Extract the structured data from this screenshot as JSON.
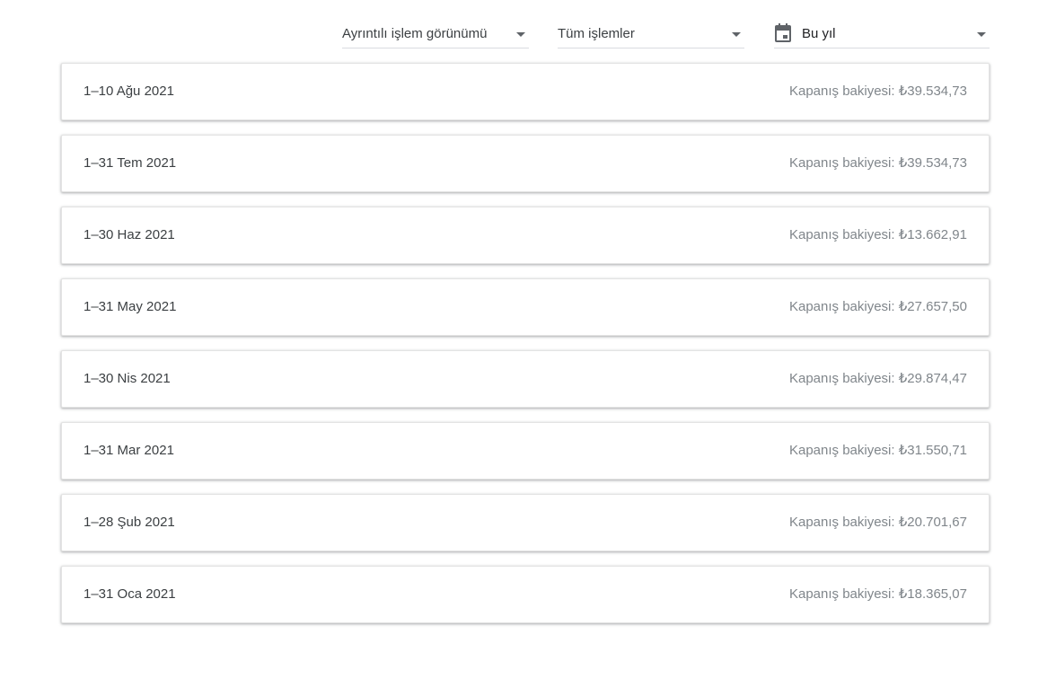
{
  "filters": {
    "view": {
      "label": "Ayrıntılı işlem görünümü"
    },
    "type": {
      "label": "Tüm işlemler"
    },
    "date": {
      "label": "Bu yıl",
      "icon": "calendar-icon"
    }
  },
  "balance_prefix": "Kapanış bakiyesi: ",
  "statements": [
    {
      "period": "1–10 Ağu 2021",
      "balance": "Kapanış bakiyesi: ₺39.534,73"
    },
    {
      "period": "1–31 Tem 2021",
      "balance": "Kapanış bakiyesi: ₺39.534,73"
    },
    {
      "period": "1–30 Haz 2021",
      "balance": "Kapanış bakiyesi: ₺13.662,91"
    },
    {
      "period": "1–31 May 2021",
      "balance": "Kapanış bakiyesi: ₺27.657,50"
    },
    {
      "period": "1–30 Nis 2021",
      "balance": "Kapanış bakiyesi: ₺29.874,47"
    },
    {
      "period": "1–31 Mar 2021",
      "balance": "Kapanış bakiyesi: ₺31.550,71"
    },
    {
      "period": "1–28 Şub 2021",
      "balance": "Kapanış bakiyesi: ₺20.701,67"
    },
    {
      "period": "1–31 Oca 2021",
      "balance": "Kapanış bakiyesi: ₺18.365,07"
    }
  ],
  "colors": {
    "text": "#3c4043",
    "muted": "#80868b",
    "divider": "#dadce0"
  }
}
